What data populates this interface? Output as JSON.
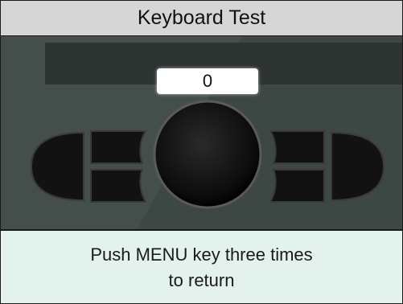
{
  "title": "Keyboard Test",
  "counter_value": "0",
  "message": {
    "line1": "Push MENU key three times",
    "line2": "to return"
  },
  "colors": {
    "title_bar": "#d6d6d6",
    "display_bg": "#3d4744",
    "message_bg": "#e4f2ee",
    "key_fill": "#101010"
  }
}
